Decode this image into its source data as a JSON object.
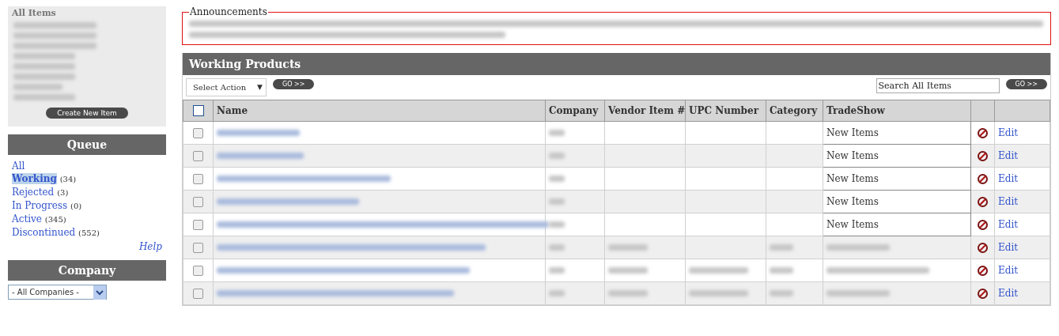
{
  "sidebar": {
    "all_items": {
      "title": "All Items",
      "lines": [
        {
          "blurred": true
        },
        {
          "blurred": true
        },
        {
          "blurred": true
        },
        {
          "blurred": true
        },
        {
          "blurred": true
        },
        {
          "blurred": true
        },
        {
          "blurred": true
        },
        {
          "blurred": true
        }
      ],
      "create_button": "Create New Item"
    },
    "queue": {
      "title": "Queue",
      "items": [
        {
          "label": "All",
          "selected": false
        },
        {
          "label": "Working",
          "count": "(34)",
          "selected": true
        },
        {
          "label": "Rejected",
          "count": "(3)",
          "selected": false
        },
        {
          "label": "In Progress",
          "count": "(0)",
          "selected": false
        },
        {
          "label": "Active",
          "count": "(345)",
          "selected": false
        },
        {
          "label": "Discontinued",
          "count": "(552)",
          "selected": false
        }
      ],
      "help": "Help"
    },
    "company": {
      "title": "Company",
      "select": "- All Companies -"
    }
  },
  "announcements": {
    "title": "Announcements",
    "body_blurred": true
  },
  "products": {
    "title": "Working Products",
    "action_select": "Select Action",
    "action_select_arrow": "▼",
    "action_go": "GO >>",
    "search_placeholder": "Search All Items",
    "search_go": "GO >>",
    "columns": [
      "Name",
      "Company",
      "Vendor Item #",
      "UPC Number",
      "Category",
      "TradeShow"
    ],
    "all_checked": false,
    "rows": [
      {
        "checked": false,
        "name_blurred": true,
        "company_blurred": true,
        "vendor_blurred": false,
        "upc_blurred": false,
        "category_blurred": false,
        "tradeshow": "New Items",
        "edit": "Edit"
      },
      {
        "checked": false,
        "name_blurred": true,
        "company_blurred": true,
        "vendor_blurred": false,
        "upc_blurred": false,
        "category_blurred": false,
        "tradeshow": "New Items",
        "edit": "Edit"
      },
      {
        "checked": false,
        "name_blurred": true,
        "company_blurred": true,
        "vendor_blurred": false,
        "upc_blurred": false,
        "category_blurred": false,
        "tradeshow": "New Items",
        "edit": "Edit"
      },
      {
        "checked": false,
        "name_blurred": true,
        "company_blurred": true,
        "vendor_blurred": false,
        "upc_blurred": false,
        "category_blurred": false,
        "tradeshow": "New Items",
        "edit": "Edit"
      },
      {
        "checked": false,
        "name_blurred": true,
        "company_blurred": true,
        "vendor_blurred": false,
        "upc_blurred": false,
        "category_blurred": false,
        "tradeshow": "New Items",
        "edit": "Edit"
      },
      {
        "checked": false,
        "name_blurred": true,
        "company_blurred": true,
        "vendor_blurred": true,
        "upc_blurred": false,
        "category_blurred": true,
        "tradeshow_blurred": true,
        "edit": "Edit"
      },
      {
        "checked": false,
        "name_blurred": true,
        "company_blurred": true,
        "vendor_blurred": true,
        "upc_blurred": true,
        "category_blurred": true,
        "tradeshow_blurred": true,
        "edit": "Edit"
      },
      {
        "checked": false,
        "name_blurred": true,
        "company_blurred": true,
        "vendor_blurred": true,
        "upc_blurred": true,
        "category_blurred": true,
        "tradeshow_blurred": true,
        "edit": "Edit"
      }
    ]
  }
}
